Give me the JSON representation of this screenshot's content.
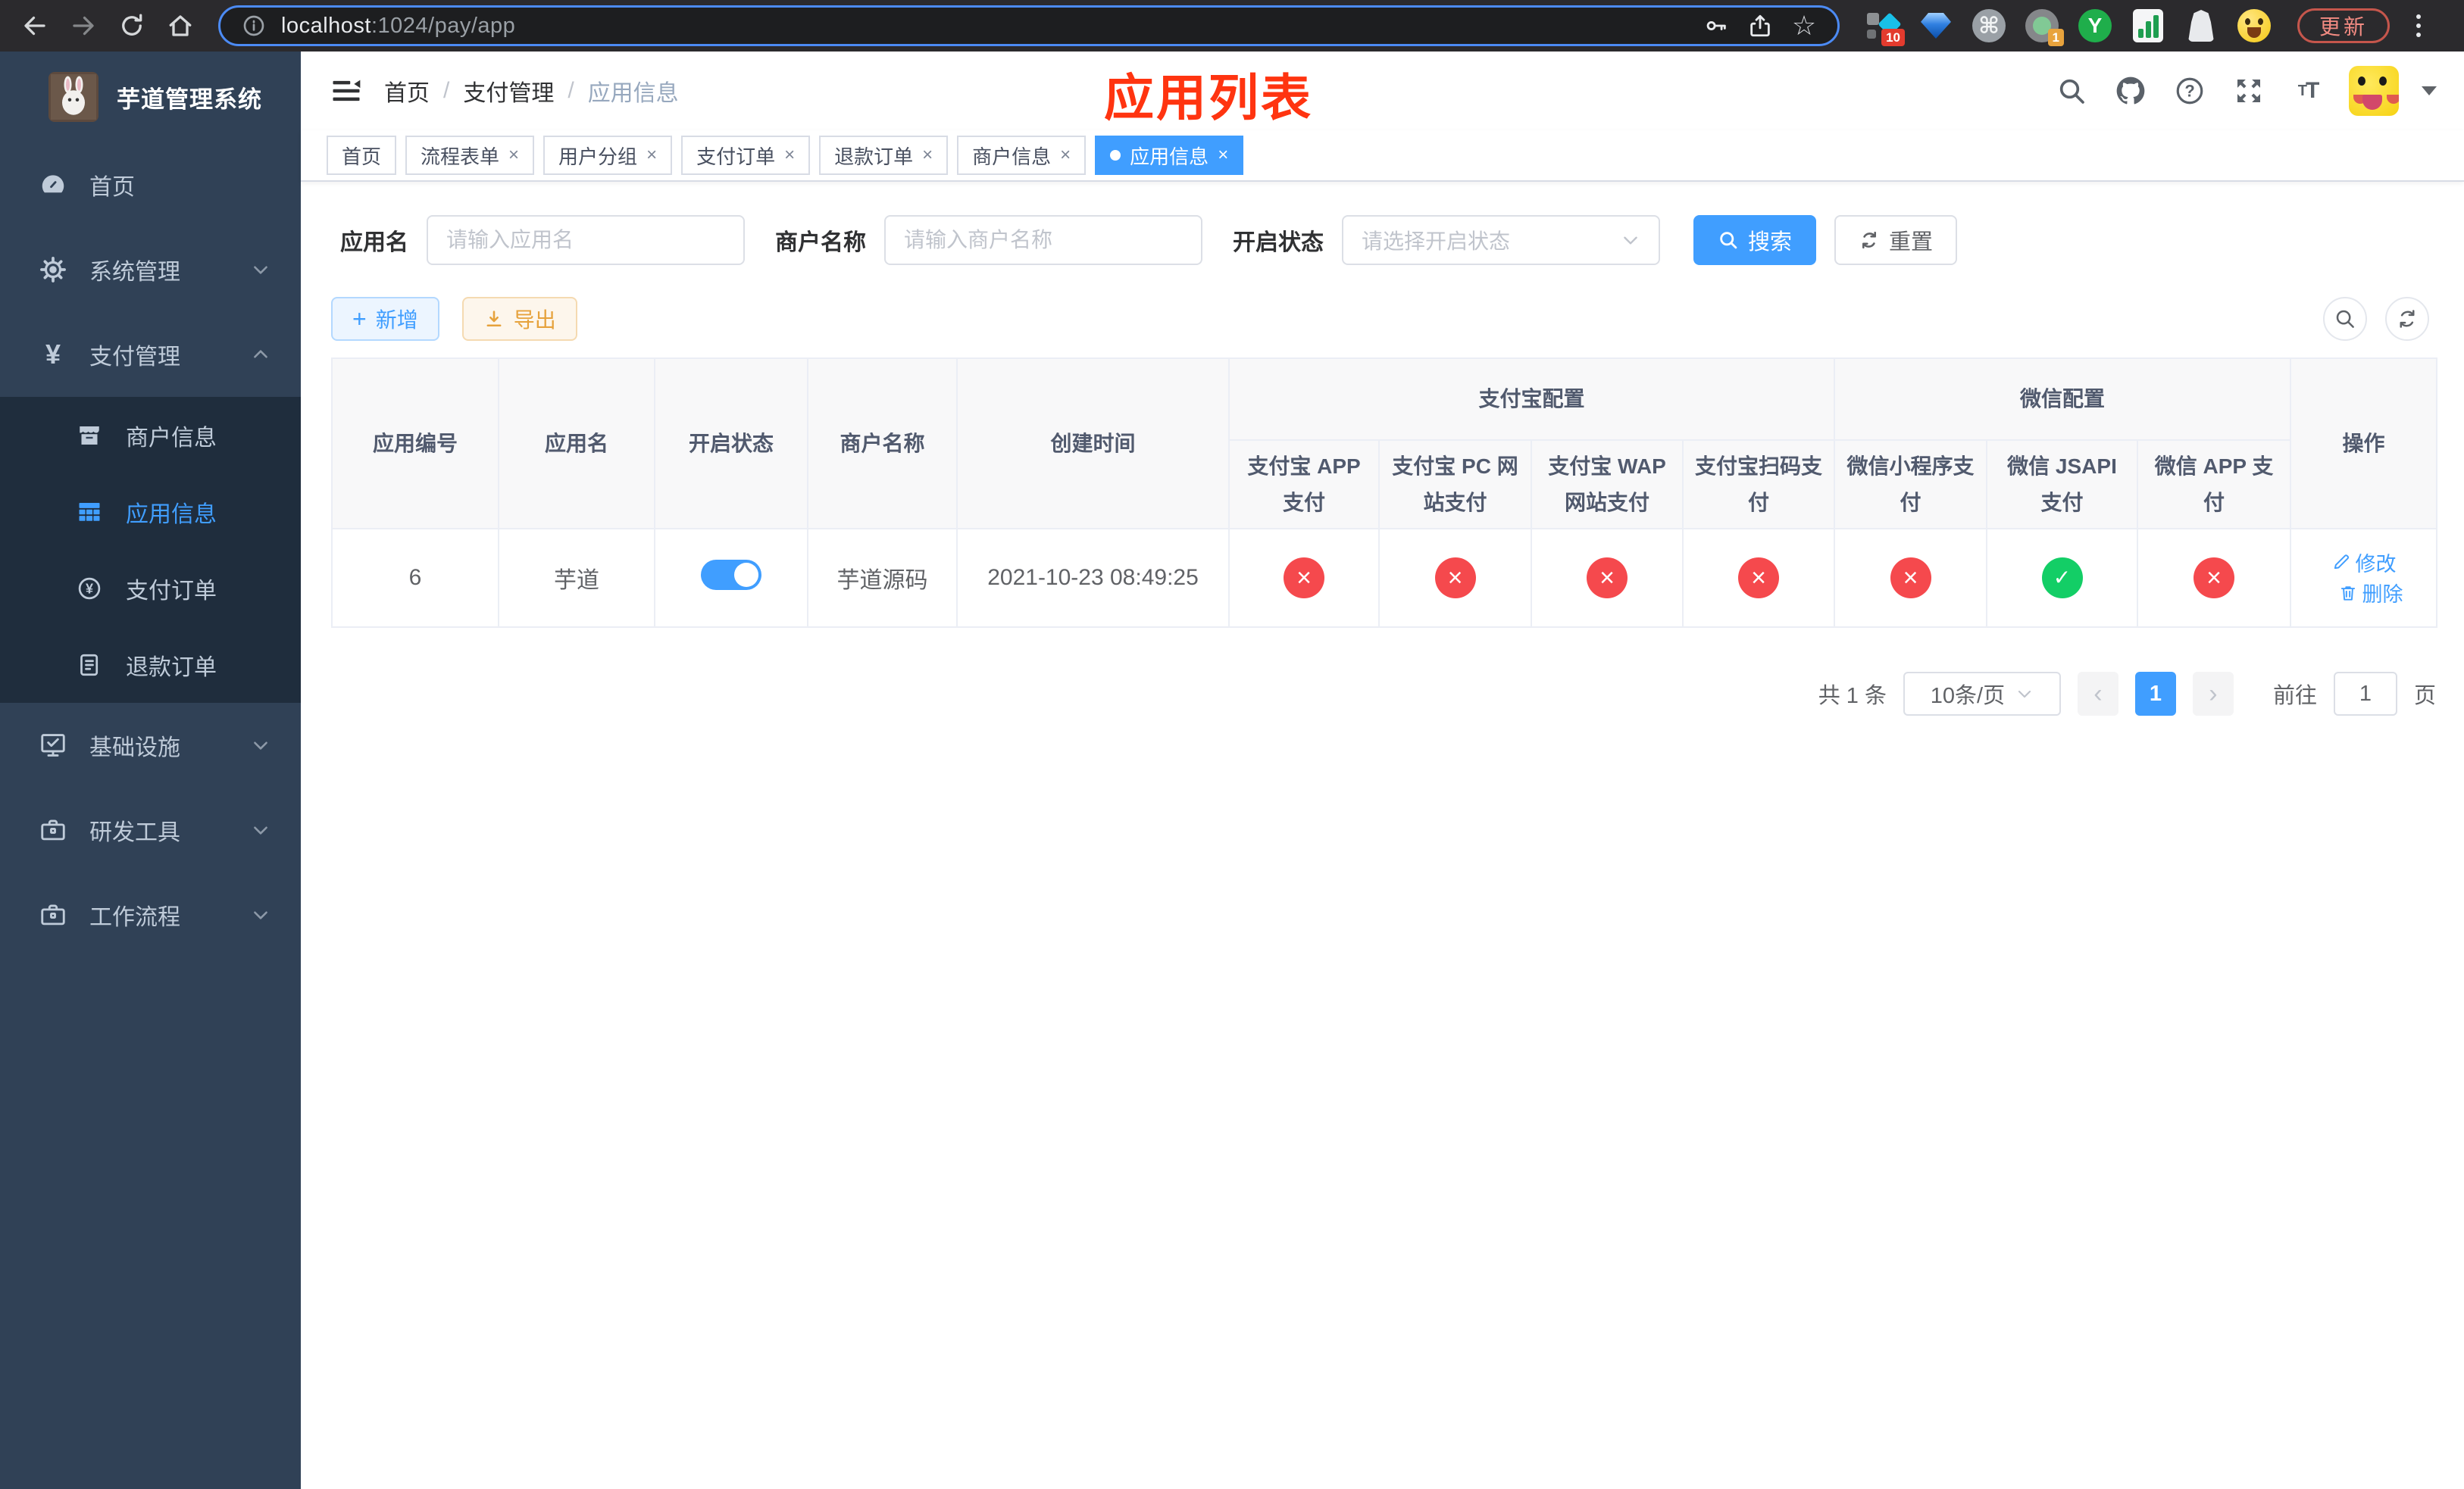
{
  "browser": {
    "url_host": "localhost",
    "url_path": ":1024/pay/app",
    "update_label": "更新",
    "ext_badge_blocks": "10",
    "ext_badge_gray": "1",
    "ext_green_letter": "Y",
    "ext_cmd_glyph": "⌘",
    "star_glyph": "☆"
  },
  "annotation": {
    "title": "应用列表",
    "color": "#ff3410"
  },
  "sidebar": {
    "title": "芋道管理系统",
    "items": [
      {
        "label": "首页"
      },
      {
        "label": "系统管理"
      },
      {
        "label": "支付管理"
      },
      {
        "label": "商户信息"
      },
      {
        "label": "应用信息"
      },
      {
        "label": "支付订单"
      },
      {
        "label": "退款订单"
      },
      {
        "label": "基础设施"
      },
      {
        "label": "研发工具"
      },
      {
        "label": "工作流程"
      }
    ],
    "yen_glyph": "¥"
  },
  "breadcrumb": {
    "items": [
      "首页",
      "支付管理",
      "应用信息"
    ],
    "separator": "/"
  },
  "tabs": [
    {
      "label": "首页"
    },
    {
      "label": "流程表单"
    },
    {
      "label": "用户分组"
    },
    {
      "label": "支付订单"
    },
    {
      "label": "退款订单"
    },
    {
      "label": "商户信息"
    },
    {
      "label": "应用信息"
    }
  ],
  "filters": {
    "app_name_label": "应用名",
    "app_name_placeholder": "请输入应用名",
    "merchant_label": "商户名称",
    "merchant_placeholder": "请输入商户名称",
    "status_label": "开启状态",
    "status_placeholder": "请选择开启状态",
    "search_label": "搜索",
    "reset_label": "重置"
  },
  "toolbar": {
    "add_label": "新增",
    "export_label": "导出"
  },
  "table": {
    "headers": {
      "app_id": "应用编号",
      "app_name": "应用名",
      "status": "开启状态",
      "merchant": "商户名称",
      "created": "创建时间",
      "alipay_group": "支付宝配置",
      "wechat_group": "微信配置",
      "actions": "操作",
      "sub": [
        "支付宝 APP 支付",
        "支付宝 PC 网站支付",
        "支付宝 WAP 网站支付",
        "支付宝扫码支付",
        "微信小程序支付",
        "微信 JSAPI 支付",
        "微信 APP 支付"
      ]
    },
    "rows": [
      {
        "app_id": "6",
        "app_name": "芋道",
        "status_enabled": true,
        "merchant": "芋道源码",
        "created": "2021-10-23 08:49:25",
        "configs": [
          false,
          false,
          false,
          false,
          false,
          true,
          false
        ],
        "edit_label": "修改",
        "delete_label": "删除"
      }
    ]
  },
  "pagination": {
    "total_label": "共 1 条",
    "page_size": "10条/页",
    "current_page": "1",
    "goto_label": "前往",
    "goto_value": "1",
    "page_unit": "页"
  },
  "colors": {
    "accent": "#409eff",
    "danger": "#f5494d",
    "success": "#13ce66",
    "warning": "#e6a23c",
    "annotation": "#ff3410",
    "sidebar": "#304156"
  }
}
